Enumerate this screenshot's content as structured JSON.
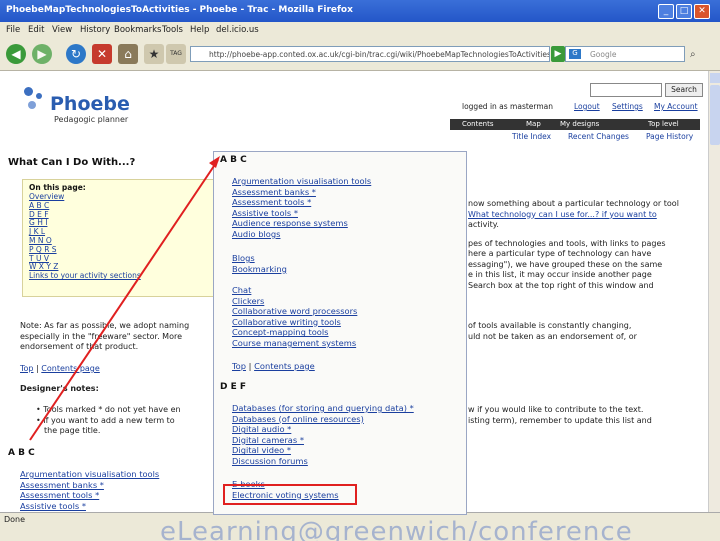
{
  "window": {
    "title": "PhoebeMapTechnologiesToActivities - Phoebe - Trac - Mozilla Firefox",
    "min": "_",
    "max": "□",
    "close": "✕"
  },
  "menu": [
    "File",
    "Edit",
    "View",
    "History",
    "Bookmarks",
    "Tools",
    "Help",
    "del.icio.us"
  ],
  "nav": {
    "url": "http://phoebe-app.conted.ox.ac.uk/cgi-bin/trac.cgi/wiki/PhoebeMapTechnologiesToActivities",
    "search_placeholder": "Google",
    "tag_label": "TAG"
  },
  "site": {
    "logo_title": "Phoebe",
    "logo_subtitle": "Pedagogic planner",
    "search_button": "Search",
    "logged_in": "logged in as masterman",
    "logout": "Logout",
    "settings": "Settings",
    "my_account": "My Account",
    "tabs": [
      "Contents",
      "Map",
      "My designs",
      "Top level"
    ],
    "subnav": [
      "Title Index",
      "Recent Changes",
      "Page History"
    ]
  },
  "page": {
    "heading": "What Can I Do With...?",
    "toc_title": "On this page:",
    "toc_items": [
      "Overview",
      "A B C",
      "D E F",
      "G H I",
      "J K L",
      "M N O",
      "P Q R S",
      "T U V",
      "W X Y Z",
      "Links to your activity sections"
    ],
    "right_text": [
      "now something about a particular technology or tool",
      "What technology can I use for...? if you want to",
      "activity.",
      "",
      "pes of technologies and tools, with links to pages",
      "here a particular type of technology can have",
      "essaging\"), we have grouped these on the same",
      "e in this list, it may occur inside another page",
      "Search box at the top right of this window and"
    ],
    "note_lines": [
      "Note: As far as possible, we adopt naming",
      "especially in the \"freeware\" sector. More",
      "endorsement of that product."
    ],
    "note_right": [
      "of tools available is constantly changing,",
      "uld not be taken as an endorsement of, or"
    ],
    "top_link": "Top",
    "contents_link": "Contents page",
    "designers_notes": "Designer's notes:",
    "bullets": [
      "Tools marked * do not yet have en",
      "If you want to add a new term to",
      "the page title."
    ],
    "bullets_right": [
      "w if you would like to contribute to the text.",
      "isting term), remember to update this list and"
    ],
    "section_abc": "A B C",
    "abc_items": [
      "Argumentation visualisation tools",
      "Assessment banks *",
      "Assessment tools *",
      "Assistive tools *"
    ]
  },
  "popup": {
    "sec1": "A B C",
    "group1": [
      "Argumentation visualisation tools",
      "Assessment banks *",
      "Assessment tools *",
      "Assistive tools *",
      "Audience response systems",
      "Audio blogs"
    ],
    "group2": [
      "Blogs",
      "Bookmarking"
    ],
    "group3": [
      "Chat",
      "Clickers",
      "Collaborative word processors",
      "Collaborative writing tools",
      "Concept-mapping tools",
      "Course management systems"
    ],
    "top": "Top",
    "contents": "Contents page",
    "sec2": "D E F",
    "group4": [
      "Databases (for storing and querying data) *",
      "Databases (of online resources)",
      "Digital audio *",
      "Digital cameras *",
      "Digital video *",
      "Discussion forums"
    ],
    "group5": [
      "E-books",
      "Electronic voting systems"
    ]
  },
  "status": {
    "text": "Done",
    "watermark": "eLearning@greenwich/conference"
  },
  "colors": {
    "link": "#1a3f9f",
    "arrow": "#e02020",
    "highlight_box": "#e02020"
  }
}
